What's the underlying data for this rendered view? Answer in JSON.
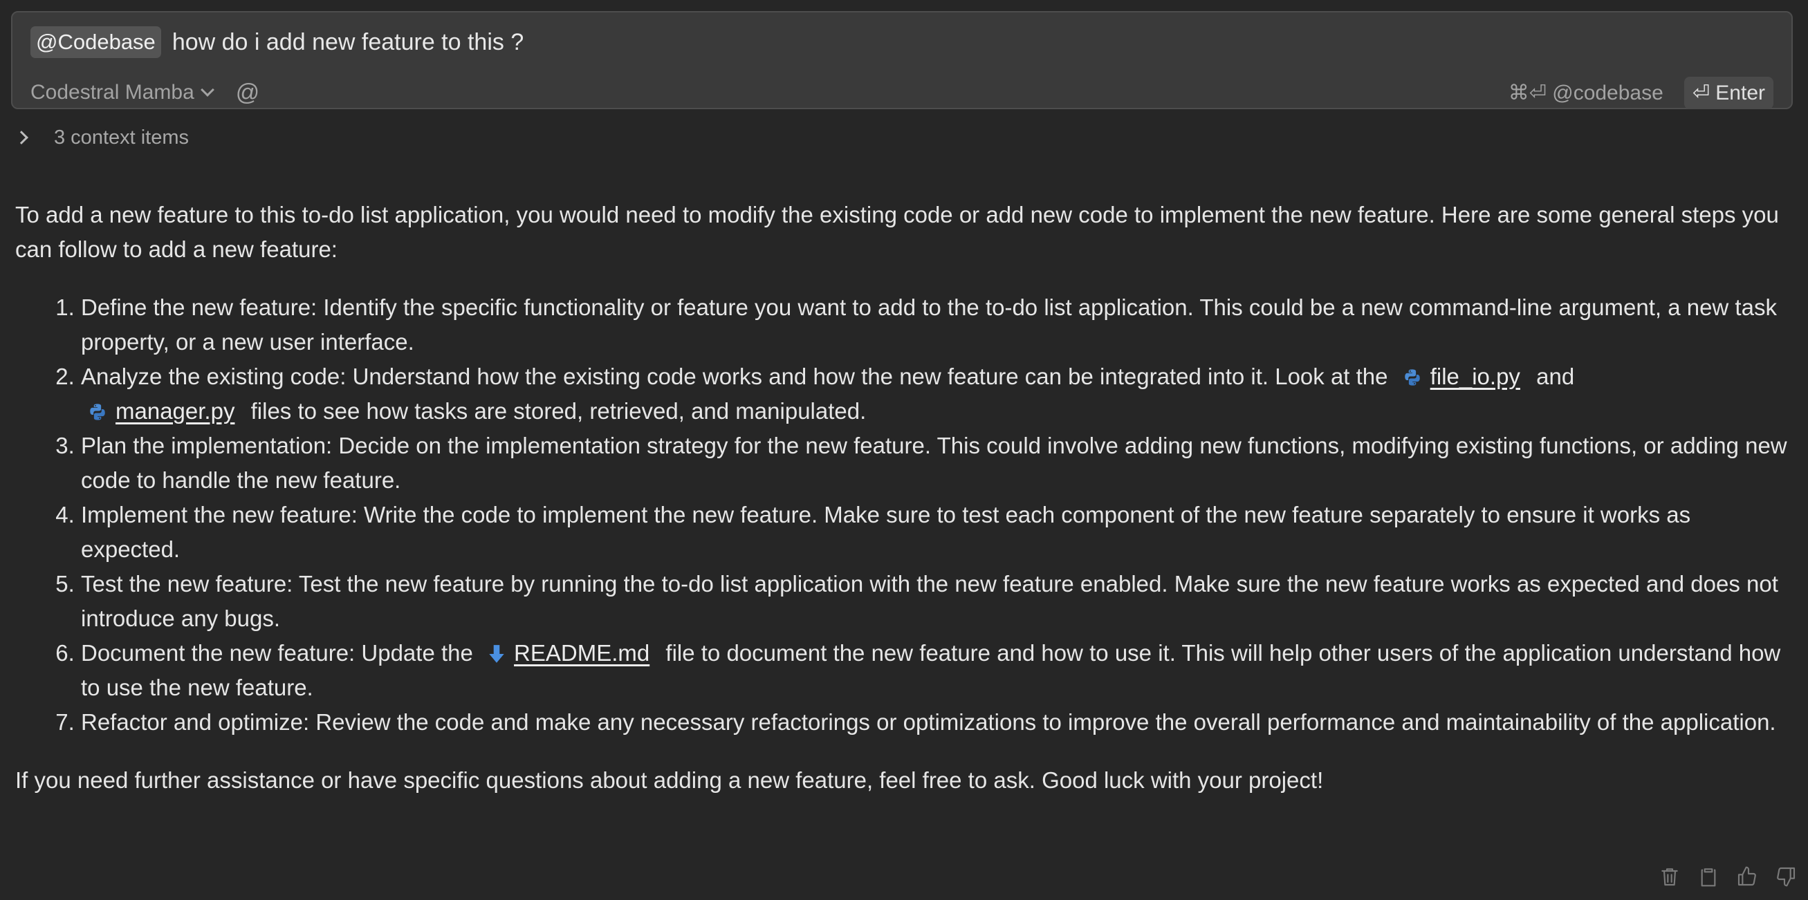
{
  "input": {
    "mention": "@Codebase",
    "text": "how do i add new feature to this ?",
    "model": "Codestral Mamba",
    "at_symbol": "@",
    "codebase_hint": "⌘⏎ @codebase",
    "enter_label": "⏎ Enter"
  },
  "context": {
    "label": "3 context items"
  },
  "response": {
    "intro": "To add a new feature to this to-do list application, you would need to modify the existing code or add new code to implement the new feature. Here are some general steps you can follow to add a new feature:",
    "steps": [
      {
        "text": "Define the new feature: Identify the specific functionality or feature you want to add to the to-do list application. This could be a new command-line argument, a new task property, or a new user interface."
      },
      {
        "before": "Analyze the existing code: Understand how the existing code works and how the new feature can be integrated into it. Look at the",
        "file1": "file_io.py",
        "middle": "and",
        "file2": "manager.py",
        "after": "files to see how tasks are stored, retrieved, and manipulated."
      },
      {
        "text": "Plan the implementation: Decide on the implementation strategy for the new feature. This could involve adding new functions, modifying existing functions, or adding new code to handle the new feature."
      },
      {
        "text": "Implement the new feature: Write the code to implement the new feature. Make sure to test each component of the new feature separately to ensure it works as expected."
      },
      {
        "text": "Test the new feature: Test the new feature by running the to-do list application with the new feature enabled. Make sure the new feature works as expected and does not introduce any bugs."
      },
      {
        "before": "Document the new feature: Update the",
        "file1": "README.md",
        "after": "file to document the new feature and how to use it. This will help other users of the application understand how to use the new feature."
      },
      {
        "text": "Refactor and optimize: Review the code and make any necessary refactorings or optimizations to improve the overall performance and maintainability of the application."
      }
    ],
    "outro": "If you need further assistance or have specific questions about adding a new feature, feel free to ask. Good luck with your project!"
  },
  "actions": [
    "trash-icon",
    "clipboard-icon",
    "thumbs-up-icon",
    "thumbs-down-icon"
  ],
  "colors": {
    "background": "#262626",
    "input_background": "#3a3a3a",
    "python_icon": "#4b8bd4",
    "markdown_icon": "#4a90e2"
  }
}
